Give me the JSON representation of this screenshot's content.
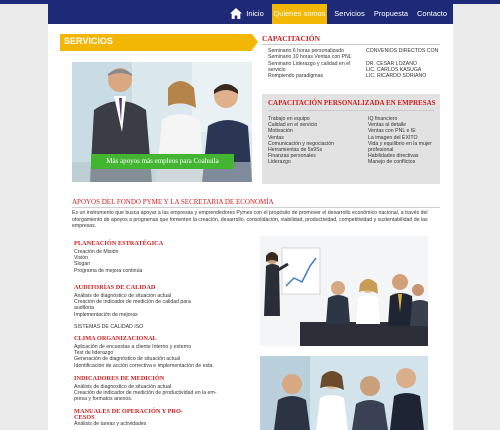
{
  "nav": {
    "items": [
      {
        "label": "Inicio",
        "active": false
      },
      {
        "label": "Quienes somos",
        "active": true
      },
      {
        "label": "Servicios",
        "active": false
      },
      {
        "label": "Propuesta",
        "active": false
      },
      {
        "label": "Contacto",
        "active": false
      }
    ]
  },
  "servicios": {
    "title": "SERVICIOS"
  },
  "photo1": {
    "caption": "Más apoyos más empleos para Coahuila"
  },
  "capacitacion": {
    "title": "CAPACITACIÓN",
    "left_lines": [
      "Seminario 6 horas personalizado",
      "Seminario 10 horas Ventas con PNL",
      "Seminario Liderazgo y calidad en el",
      "servicio",
      "Rompiendo paradigmas"
    ],
    "right_lines": [
      "CONVENIOS DIRECTOS CON",
      "",
      "DR. CESAR LOZANO",
      "LIC. CARLOS KASUGA",
      "LIC. RICARDO SORIANO"
    ]
  },
  "personalizada": {
    "title": "CAPACITACIÓN PERSONALIZADA EN EMPRESAS",
    "col1": [
      "Trabajo en equipo",
      "Calidad en el servicio",
      "Motivación",
      "Ventas",
      "Comunicación y negociación",
      "Herramientas de 5s9Ss",
      "Finanzas personales",
      "Liderazgo"
    ],
    "col2": [
      "IQ financiero",
      "Ventas al detalle",
      "Ventas con PNL e IE",
      "La imagen del ÉXITO",
      "Vida y equilibrio en la mujer",
      "profesional",
      "Habilidades directivas",
      "Manejo de conflictos"
    ]
  },
  "apoyos": {
    "title": "APOYOS DEL FONDO PYME Y LA  SECRETARIA DE ECONOMÍA",
    "text": "Es un instrumento que busca apoyar a las empresas y emprendedores Pymes con el propósito de promover el desarrollo económico nacional, a través del otorgamiento de apoyos a programas que fomenten la creación, desarrollo, consolidación, viabilidad, productividad, competitividad y sustentabilidad de las empresas."
  },
  "sections": [
    {
      "title": "PLANEACIÓN ESTRATÉGICA",
      "lines": [
        "Creación de Misión",
        "Visión",
        "Slogan",
        "Programa de mejora continúa"
      ]
    },
    {
      "title": "AUDITORÍAS DE CALIDAD",
      "lines": [
        "Análisis de diagnóstico de situación actual",
        "Creación de indicador de medición de calidad para",
        "auditoria",
        "Implementación de mejoras",
        "",
        "SISTEMAS DE CALIDAD ISO"
      ]
    },
    {
      "title": "CLIMA ORGANIZACIONAL",
      "lines": [
        "Aplicación de encuestas a cliente Interno y externo",
        "Test de liderazgo",
        "Generación de diagnóstico de situación actual",
        "Identificación de acción correctiva e implementación de esta."
      ]
    },
    {
      "title": "INDICADORES DE MEDICIÓN",
      "lines": [
        "Análisis de diagnostico de situación actual",
        "Creación de indicador de medición de productividad en la em-",
        "presa y formatos anexos."
      ]
    },
    {
      "title": "MANUALES DE OPERACIÓN Y PRO-",
      "lines": [
        "CESOS",
        "Análisis de tareas y actividades"
      ]
    }
  ],
  "colors": {
    "navy": "#1e2a78",
    "accent": "#f2b705",
    "red": "#cc1e1e",
    "green": "#43b533"
  }
}
